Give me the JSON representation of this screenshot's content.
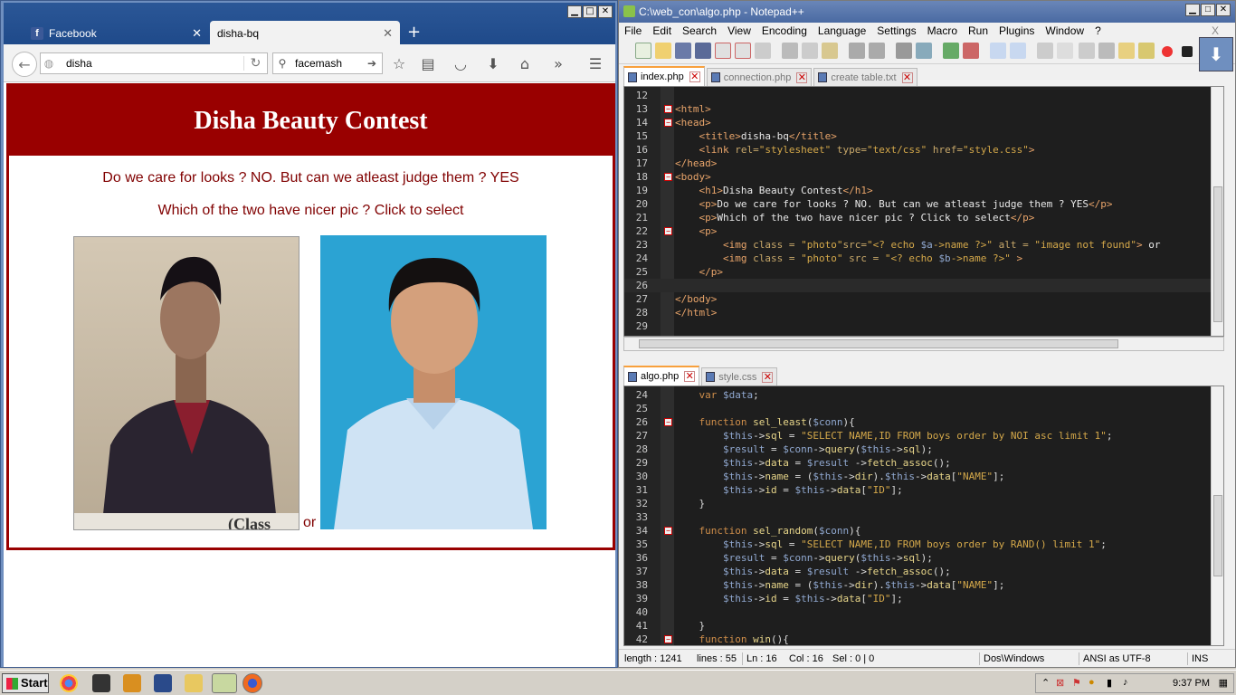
{
  "firefox": {
    "tabs": [
      {
        "label": "Facebook",
        "icon": "facebook-icon"
      },
      {
        "label": "disha-bq",
        "icon": ""
      }
    ],
    "url": "disha",
    "search_value": "facemash",
    "page": {
      "heading": "Disha Beauty Contest",
      "line1": "Do we care for looks ? NO. But can we atleast judge them ? YES",
      "line2": "Which of the two have nicer pic ? Click to select",
      "or_text": "or",
      "photo1_caption": "(Class"
    },
    "accent_color": "#990000"
  },
  "notepad": {
    "title": "C:\\web_con\\algo.php - Notepad++",
    "menu": [
      "File",
      "Edit",
      "Search",
      "View",
      "Encoding",
      "Language",
      "Settings",
      "Macro",
      "Run",
      "Plugins",
      "Window",
      "?"
    ],
    "menu_close": "X",
    "top_tabs": [
      {
        "label": "index.php",
        "active": true
      },
      {
        "label": "connection.php",
        "active": false
      },
      {
        "label": "create table.txt",
        "active": false
      }
    ],
    "bottom_tabs": [
      {
        "label": "algo.php",
        "active": true
      },
      {
        "label": "style.css",
        "active": false
      }
    ],
    "status": {
      "length": "length : 1241",
      "lines": "lines : 55",
      "ln": "Ln : 16",
      "col": "Col : 16",
      "sel": "Sel : 0 | 0",
      "eol": "Dos\\Windows",
      "encoding": "ANSI as UTF-8",
      "mode": "INS"
    }
  },
  "taskbar": {
    "start_label": "Start",
    "clock": "9:37 PM"
  }
}
